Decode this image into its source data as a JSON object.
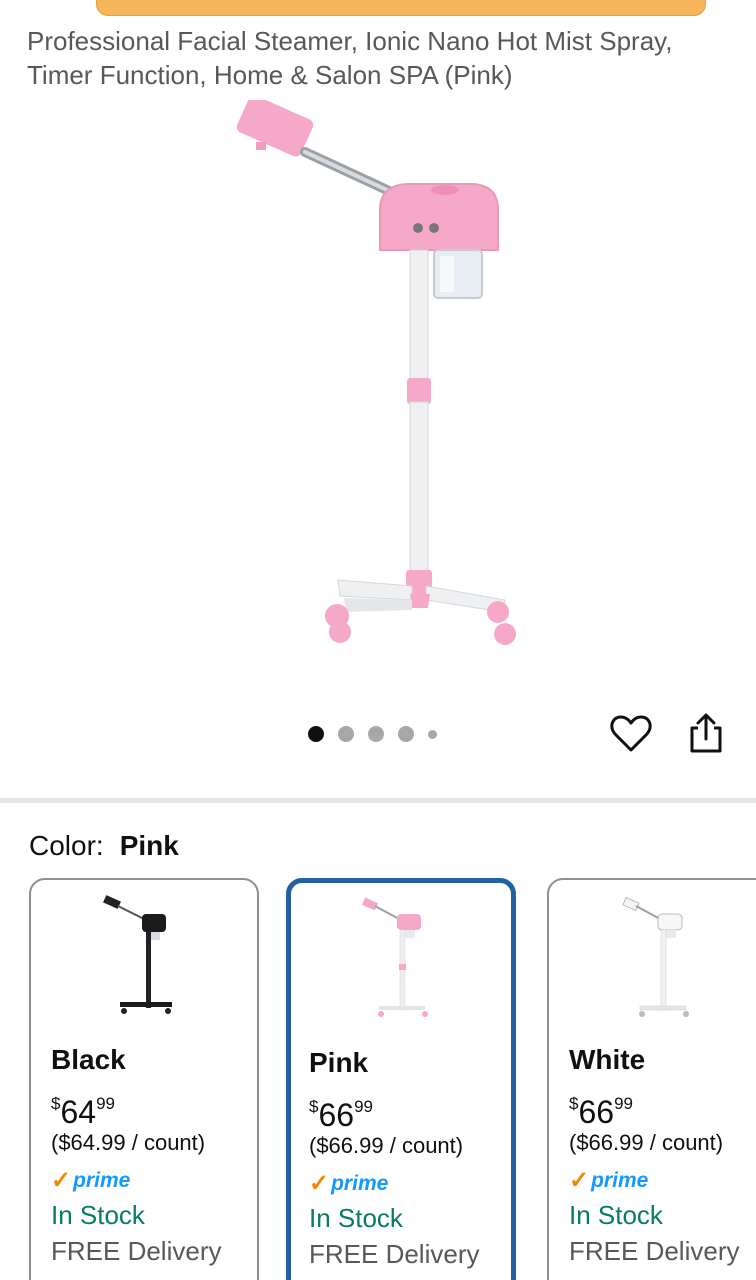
{
  "product": {
    "title": "Professional Facial Steamer, Ionic Nano Hot Mist Spray, Timer Function, Home & Salon SPA (Pink)"
  },
  "gallery": {
    "image_count": 5,
    "active_index": 0,
    "wishlist_icon": "heart-icon",
    "share_icon": "share-icon"
  },
  "color_selector": {
    "label": "Color:",
    "selected": "Pink"
  },
  "variants": [
    {
      "name": "Black",
      "price_symbol": "$",
      "price_whole": "64",
      "price_fraction": "99",
      "unit_price": "($64.99 / count)",
      "prime": "prime",
      "stock": "In Stock",
      "delivery": "FREE Delivery",
      "color": "#1b1b1b"
    },
    {
      "name": "Pink",
      "price_symbol": "$",
      "price_whole": "66",
      "price_fraction": "99",
      "unit_price": "($66.99 / count)",
      "prime": "prime",
      "stock": "In Stock",
      "delivery": "FREE Delivery",
      "color": "#f2a6c8"
    },
    {
      "name": "White",
      "price_symbol": "$",
      "price_whole": "66",
      "price_fraction": "99",
      "unit_price": "($66.99 / count)",
      "prime": "prime",
      "stock": "In Stock",
      "delivery": "FREE Delivery",
      "color": "#f4f4f4"
    }
  ],
  "colors": {
    "selected_border": "#2162a1",
    "in_stock": "#067d62",
    "prime_blue": "#1399ff",
    "prime_check": "#f08804",
    "product_pink": "#f2a6c8"
  }
}
